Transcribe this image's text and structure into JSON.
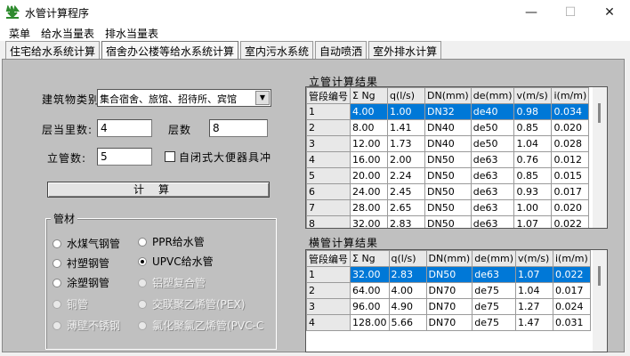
{
  "window": {
    "title": "水管计算程序",
    "minimize": "—",
    "maximize": "☐",
    "close": "✕",
    "icon_color": "#2e8b2e"
  },
  "menu": [
    "菜单",
    "给水当量表",
    "排水当量表"
  ],
  "tabs": [
    "住宅给水系统计算",
    "宿舍办公楼等给水系统计算",
    "室内污水系统",
    "自动喷洒",
    "室外排水计算"
  ],
  "form": {
    "building_type_label": "建筑物类别",
    "building_type_value": "集合宿舍、旅馆、招待所、宾馆",
    "floor_eq_label": "层当里数:",
    "floor_eq_value": "4",
    "floors_label": "层数",
    "floors_value": "8",
    "riser_label": "立管数:",
    "riser_value": "5",
    "flush_label": "自闭式大便器具冲",
    "calc_label": "计算"
  },
  "materials": {
    "title": "管材",
    "items": [
      {
        "label": "水煤气钢管",
        "selected": false,
        "disabled": false
      },
      {
        "label": "PPR给水管",
        "selected": false,
        "disabled": false
      },
      {
        "label": "衬塑钢管",
        "selected": false,
        "disabled": false
      },
      {
        "label": "UPVC给水管",
        "selected": true,
        "disabled": false
      },
      {
        "label": "涂塑钢管",
        "selected": false,
        "disabled": false
      },
      {
        "label": "铝塑复合管",
        "selected": false,
        "disabled": true
      },
      {
        "label": "铜管",
        "selected": false,
        "disabled": true
      },
      {
        "label": "交联聚乙烯管(PEX)",
        "selected": false,
        "disabled": true
      },
      {
        "label": "薄壁不锈钢",
        "selected": false,
        "disabled": true
      },
      {
        "label": "氯化聚氯乙烯管(PVC-C",
        "selected": false,
        "disabled": true
      }
    ]
  },
  "riser_table": {
    "title": "立管计算结果",
    "headers": [
      "管段编号",
      "Σ Ng",
      "q(l/s)",
      "DN(mm)",
      "de(mm)",
      "v(m/s)",
      "i(m/m)"
    ],
    "rows": [
      [
        "1",
        "4.00",
        "1.00",
        "DN32",
        "de40",
        "0.98",
        "0.034"
      ],
      [
        "2",
        "8.00",
        "1.41",
        "DN40",
        "de50",
        "0.85",
        "0.020"
      ],
      [
        "3",
        "12.00",
        "1.73",
        "DN40",
        "de50",
        "1.04",
        "0.028"
      ],
      [
        "4",
        "16.00",
        "2.00",
        "DN50",
        "de63",
        "0.76",
        "0.012"
      ],
      [
        "5",
        "20.00",
        "2.24",
        "DN50",
        "de63",
        "0.85",
        "0.015"
      ],
      [
        "6",
        "24.00",
        "2.45",
        "DN50",
        "de63",
        "0.93",
        "0.017"
      ],
      [
        "7",
        "28.00",
        "2.65",
        "DN50",
        "de63",
        "1.00",
        "0.020"
      ],
      [
        "8",
        "32.00",
        "2.83",
        "DN50",
        "de63",
        "1.07",
        "0.022"
      ]
    ]
  },
  "horizontal_table": {
    "title": "横管计算结果",
    "headers": [
      "管段编号",
      "Σ Ng",
      "q(l/s)",
      "DN(mm)",
      "de(mm)",
      "v(m/s)",
      "i(m/m)"
    ],
    "rows": [
      [
        "1",
        "32.00",
        "2.83",
        "DN50",
        "de63",
        "1.07",
        "0.022"
      ],
      [
        "2",
        "64.00",
        "4.00",
        "DN70",
        "de75",
        "1.04",
        "0.017"
      ],
      [
        "3",
        "96.00",
        "4.90",
        "DN70",
        "de75",
        "1.27",
        "0.024"
      ],
      [
        "4",
        "128.00",
        "5.66",
        "DN70",
        "de75",
        "1.47",
        "0.031"
      ]
    ]
  },
  "colors": {
    "selection": "#0078d7",
    "panel": "#c0c0c0"
  }
}
